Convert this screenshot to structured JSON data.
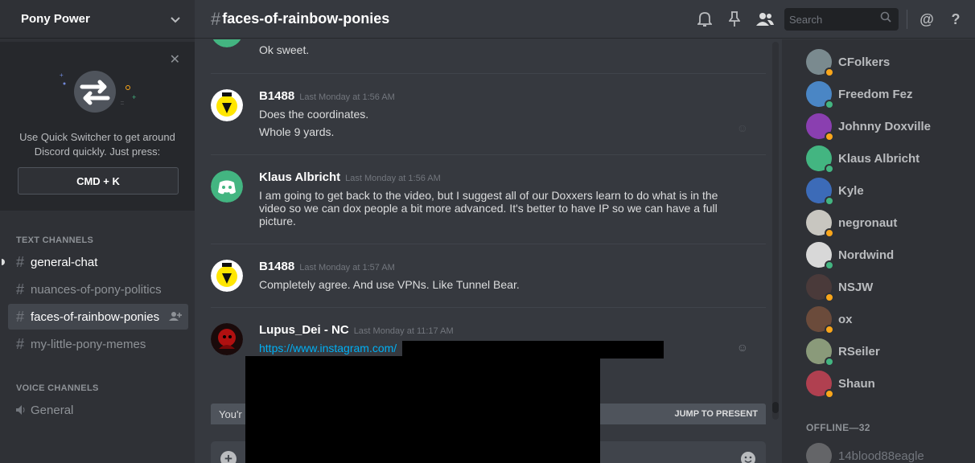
{
  "colors": {
    "online": "#43b581",
    "idle": "#faa61a",
    "link": "#00b0f4"
  },
  "server": {
    "name": "Pony Power"
  },
  "quick_switcher": {
    "text": "Use Quick Switcher to get around Discord quickly. Just press:",
    "shortcut": "CMD + K"
  },
  "categories": {
    "text": "TEXT CHANNELS",
    "voice": "VOICE CHANNELS"
  },
  "text_channels": [
    {
      "name": "general-chat",
      "state": "unread"
    },
    {
      "name": "nuances-of-pony-politics",
      "state": "read"
    },
    {
      "name": "faces-of-rainbow-ponies",
      "state": "active"
    },
    {
      "name": "my-little-pony-memes",
      "state": "read"
    }
  ],
  "voice_channels": [
    {
      "name": "General"
    }
  ],
  "header": {
    "hash": "#",
    "channel": "faces-of-rainbow-ponies",
    "search_placeholder": "Search",
    "icons": [
      "bell-icon",
      "pin-icon",
      "members-icon",
      "search-icon",
      "mention-icon",
      "help-icon"
    ],
    "mention_glyph": "@",
    "help_glyph": "?"
  },
  "messages": [
    {
      "lines": [
        "Ok sweet."
      ]
    },
    {
      "author": "B1488",
      "timestamp": "Last Monday at 1:56 AM",
      "lines": [
        "Does the coordinates.",
        "Whole 9 yards."
      ]
    },
    {
      "author": "Klaus Albricht",
      "timestamp": "Last Monday at 1:56 AM",
      "lines": [
        "I am going to get back to the video, but I suggest all of our Doxxers learn to do what is in the",
        "video so we can dox people a bit more advanced. It's better to have IP so we can have a full",
        "picture."
      ]
    },
    {
      "author": "B1488",
      "timestamp": "Last Monday at 1:57 AM",
      "lines": [
        "Completely agree. And use VPNs. Like Tunnel Bear."
      ]
    },
    {
      "author": "Lupus_Dei - NC",
      "timestamp": "Last Monday at 11:17 AM",
      "lines": [
        "https://www.instagram.com/"
      ]
    }
  ],
  "jump_bar": {
    "left_text": "You'r",
    "button": "JUMP TO PRESENT"
  },
  "members": {
    "online": [
      {
        "name": "CFolkers",
        "status": "idle",
        "color": "#7a8a8f"
      },
      {
        "name": "Freedom Fez",
        "status": "online",
        "color": "#4a86c5"
      },
      {
        "name": "Johnny Doxville",
        "status": "idle",
        "color": "#8a3fb0"
      },
      {
        "name": "Klaus Albricht",
        "status": "online",
        "color": "#43b581"
      },
      {
        "name": "Kyle",
        "status": "online",
        "color": "#3c6bb8"
      },
      {
        "name": "negronaut",
        "status": "idle",
        "color": "#c8c6c0"
      },
      {
        "name": "Nordwind",
        "status": "online",
        "color": "#d8d8d8"
      },
      {
        "name": "NSJW",
        "status": "idle",
        "color": "#4a3a3a"
      },
      {
        "name": "ox",
        "status": "idle",
        "color": "#6b4b3b"
      },
      {
        "name": "RSeiler",
        "status": "online",
        "color": "#8a9a7a"
      },
      {
        "name": "Shaun",
        "status": "idle",
        "color": "#b04050"
      }
    ],
    "offline_label": "OFFLINE—32",
    "offline": [
      {
        "name": "14blood88eagle",
        "color": "#9a9a9a"
      }
    ]
  }
}
